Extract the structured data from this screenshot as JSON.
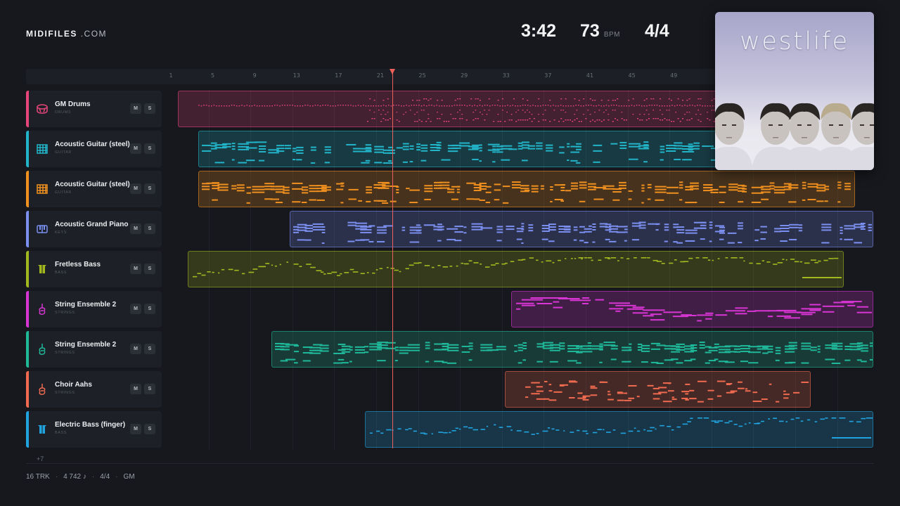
{
  "brand": {
    "name": "MIDIFILES",
    "suffix": ".COM"
  },
  "stats": {
    "duration": "3:42",
    "bpm": "73",
    "bpm_unit": "BPM",
    "time_signature": "4/4"
  },
  "ruler": {
    "bars": [
      "1",
      "5",
      "9",
      "13",
      "17",
      "21",
      "25",
      "29",
      "33",
      "37",
      "41",
      "45",
      "49"
    ]
  },
  "playhead_bar": 22,
  "tracks": [
    {
      "name": "GM Drums",
      "category": "DRUMS",
      "color": "#e6457a",
      "icon": "drum-icon",
      "mute": "M",
      "solo": "S"
    },
    {
      "name": "Acoustic Guitar (steel)",
      "category": "GUITAR",
      "color": "#22b5c9",
      "icon": "guitar-fretboard-icon",
      "mute": "M",
      "solo": "S"
    },
    {
      "name": "Acoustic Guitar (steel)",
      "category": "GUITAR",
      "color": "#f0901f",
      "icon": "guitar-fretboard-icon",
      "mute": "M",
      "solo": "S"
    },
    {
      "name": "Acoustic Grand Piano",
      "category": "KEYS",
      "color": "#7b8ff0",
      "icon": "piano-keys-icon",
      "mute": "M",
      "solo": "S"
    },
    {
      "name": "Fretless Bass",
      "category": "BASS",
      "color": "#a3b81f",
      "icon": "bass-icon",
      "mute": "M",
      "solo": "S"
    },
    {
      "name": "String Ensemble 2",
      "category": "STRINGS",
      "color": "#d835d4",
      "icon": "violin-icon",
      "mute": "M",
      "solo": "S"
    },
    {
      "name": "String Ensemble 2",
      "category": "STRINGS",
      "color": "#1fb99a",
      "icon": "violin-icon",
      "mute": "M",
      "solo": "S"
    },
    {
      "name": "Choir Aahs",
      "category": "STRINGS",
      "color": "#ef6a4e",
      "icon": "violin-icon",
      "mute": "M",
      "solo": "S"
    },
    {
      "name": "Electric Bass (finger)",
      "category": "BASS",
      "color": "#21a3df",
      "icon": "bass-icon",
      "mute": "M",
      "solo": "S"
    }
  ],
  "more_tracks": "+7",
  "footer": {
    "tracks": "16 TRK",
    "notes": "4 742 ♪",
    "time_signature": "4/4",
    "standard": "GM"
  },
  "cover": {
    "artist": "westlife"
  }
}
